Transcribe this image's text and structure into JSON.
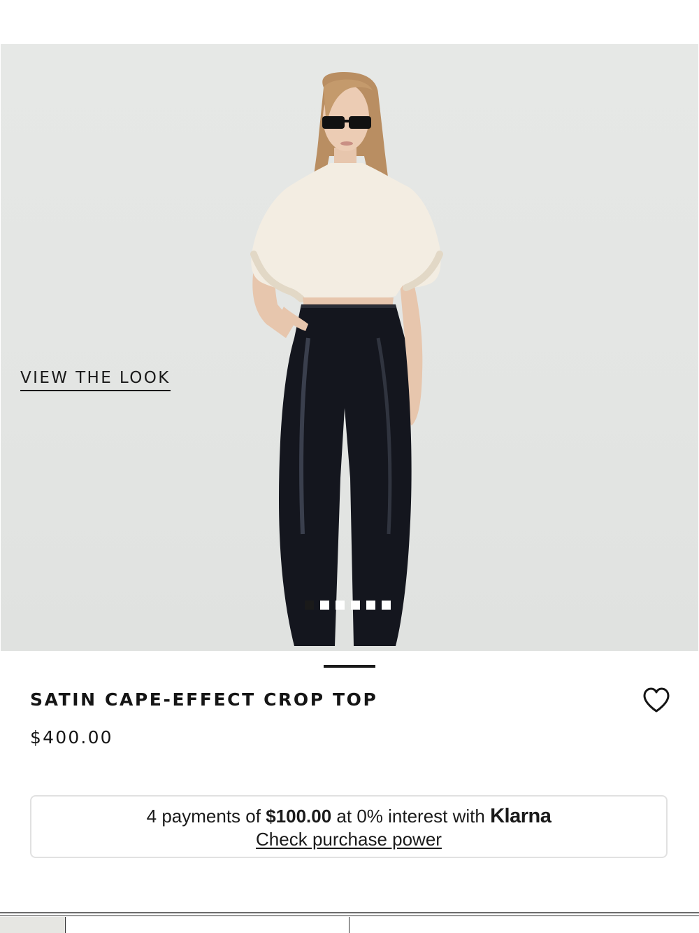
{
  "hero": {
    "view_the_look_label": "VIEW THE LOOK",
    "carousel": {
      "total_slides": 6,
      "active_index": 0
    },
    "background_color": "#e4e6e4"
  },
  "product": {
    "title": "SATIN CAPE-EFFECT CROP TOP",
    "price": "$400.00",
    "wishlist_icon": "heart-outline-icon"
  },
  "klarna": {
    "prefix": "4 payments of ",
    "amount": "$100.00",
    "middle": " at 0% interest with ",
    "brand": "Klarna",
    "link_label": "Check purchase power"
  },
  "colors": {
    "text": "#151515",
    "box_border": "#e1e1e1",
    "dot_active": "#1a1a1a",
    "dot_inactive": "#ffffff"
  }
}
